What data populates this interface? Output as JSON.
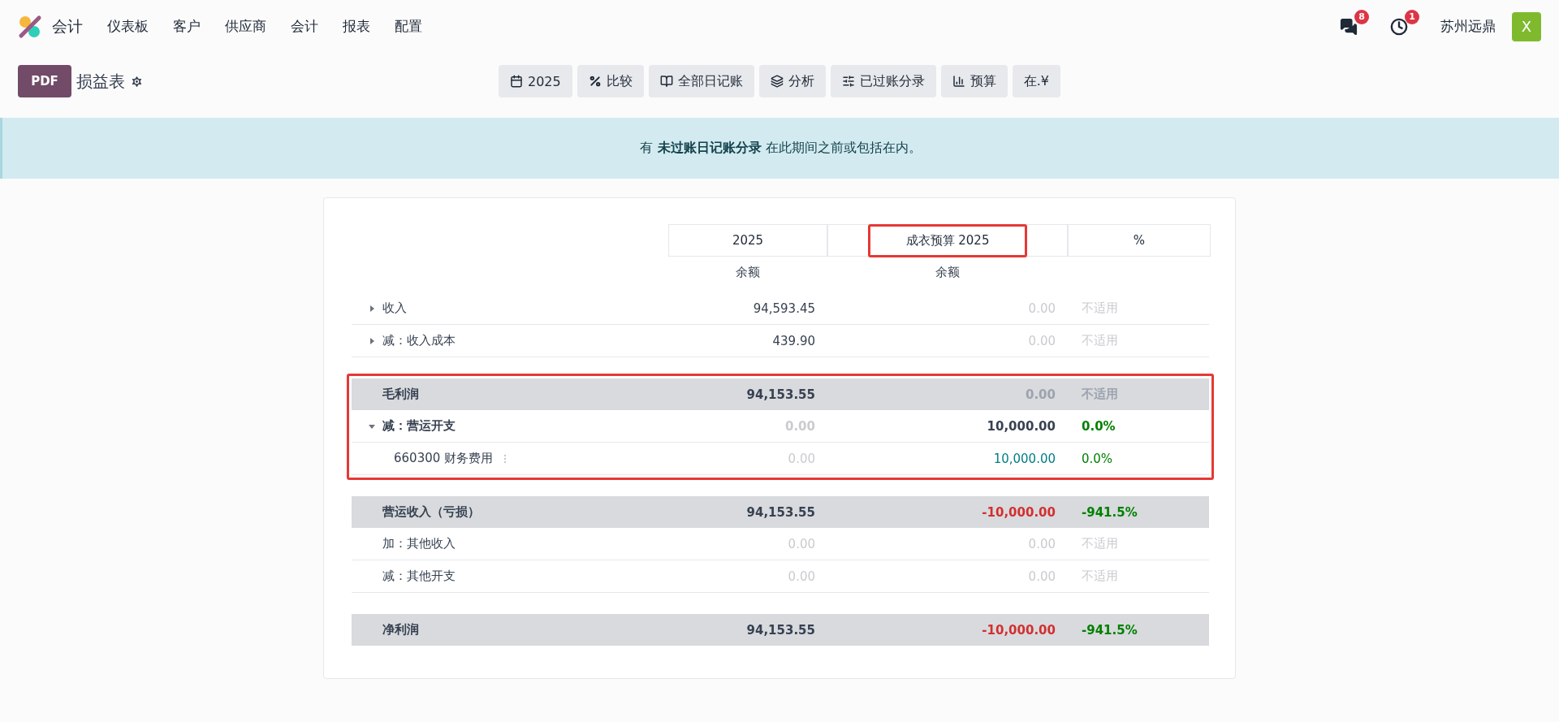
{
  "app": {
    "name": "会计",
    "menu": [
      "仪表板",
      "客户",
      "供应商",
      "会计",
      "报表",
      "配置"
    ]
  },
  "systray": {
    "messages_count": "8",
    "activities_count": "1",
    "company": "苏州远鼎",
    "avatar": "X"
  },
  "control_panel": {
    "pdf_button": "PDF",
    "title": "损益表",
    "filters": [
      {
        "kind": "calendar",
        "label": "2025"
      },
      {
        "kind": "percent",
        "label": "比较"
      },
      {
        "kind": "book",
        "label": "全部日记账"
      },
      {
        "kind": "layers",
        "label": "分析"
      },
      {
        "kind": "sliders",
        "label": "已过账分录"
      },
      {
        "kind": "chart",
        "label": "预算"
      },
      {
        "kind": "currency",
        "label": "在.¥"
      }
    ]
  },
  "alert": "有 **未过账日记账分录** 在此期间之前或包括在内。",
  "report": {
    "columns": [
      {
        "label": "2025",
        "sub": "余额",
        "highlighted": false
      },
      {
        "label": "成衣预算 2025",
        "sub": "余额",
        "highlighted": true
      },
      {
        "label": "%",
        "highlighted": false
      }
    ],
    "sections": [
      {
        "highlighted": false,
        "rows": [
          {
            "kind": "line",
            "label": "收入",
            "expanded": false,
            "cells": [
              {
                "text": "94,593.45",
                "kind": "plain"
              },
              {
                "text": "0.00",
                "kind": "muted"
              },
              {
                "text": "不适用",
                "kind": "muted"
              }
            ]
          },
          {
            "kind": "line",
            "label": "减：收入成本",
            "expanded": false,
            "cells": [
              {
                "text": "439.90",
                "kind": "plain"
              },
              {
                "text": "0.00",
                "kind": "muted"
              },
              {
                "text": "不适用",
                "kind": "muted"
              }
            ]
          }
        ]
      },
      {
        "highlighted": true,
        "rows": [
          {
            "kind": "total",
            "label": "毛利润",
            "cells": [
              {
                "text": "94,153.55",
                "kind": "plain"
              },
              {
                "text": "0.00",
                "kind": "muted"
              },
              {
                "text": "不适用",
                "kind": "muted"
              }
            ]
          },
          {
            "kind": "group",
            "label": "减：营运开支",
            "expanded": true,
            "cells": [
              {
                "text": "0.00",
                "kind": "muted"
              },
              {
                "text": "10,000.00",
                "kind": "plain"
              },
              {
                "text": "0.0%",
                "kind": "positive"
              }
            ]
          },
          {
            "kind": "account",
            "label": "660300 财务费用",
            "cells": [
              {
                "text": "0.00",
                "kind": "muted"
              },
              {
                "text": "10,000.00",
                "kind": "link"
              },
              {
                "text": "0.0%",
                "kind": "positive"
              }
            ]
          }
        ]
      },
      {
        "highlighted": false,
        "rows": [
          {
            "kind": "total",
            "label": "营运收入（亏损）",
            "cells": [
              {
                "text": "94,153.55",
                "kind": "plain"
              },
              {
                "text": "-10,000.00",
                "kind": "negative"
              },
              {
                "text": "-941.5%",
                "kind": "positive"
              }
            ]
          },
          {
            "kind": "line",
            "label": "加：其他收入",
            "cells": [
              {
                "text": "0.00",
                "kind": "muted"
              },
              {
                "text": "0.00",
                "kind": "muted"
              },
              {
                "text": "不适用",
                "kind": "muted"
              }
            ]
          },
          {
            "kind": "line",
            "label": "减：其他开支",
            "cells": [
              {
                "text": "0.00",
                "kind": "muted"
              },
              {
                "text": "0.00",
                "kind": "muted"
              },
              {
                "text": "不适用",
                "kind": "muted"
              }
            ]
          }
        ]
      },
      {
        "highlighted": false,
        "rows": [
          {
            "kind": "total",
            "label": "净利润",
            "cells": [
              {
                "text": "94,153.55",
                "kind": "plain"
              },
              {
                "text": "-10,000.00",
                "kind": "negative"
              },
              {
                "text": "-941.5%",
                "kind": "positive"
              }
            ]
          }
        ]
      }
    ]
  }
}
